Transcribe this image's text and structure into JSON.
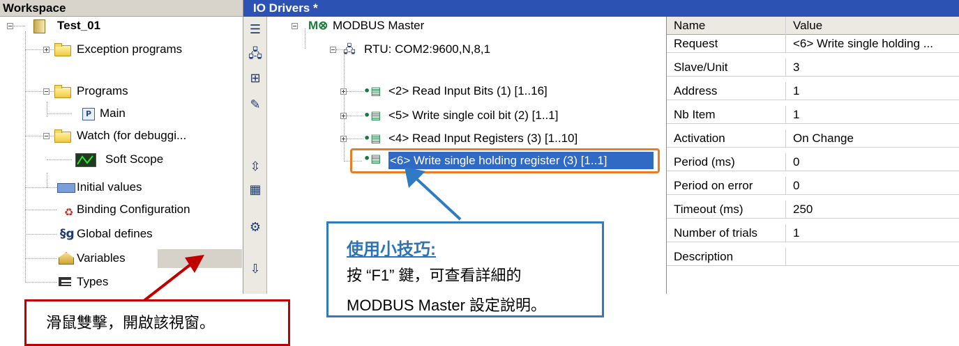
{
  "workspace": {
    "title": "Workspace",
    "project": "Test_01",
    "items": [
      {
        "label": "Exception programs"
      },
      {
        "label": "Programs"
      },
      {
        "label": "Main"
      },
      {
        "label": "Watch (for debuggi..."
      },
      {
        "label": "Soft Scope"
      },
      {
        "label": "Initial values"
      },
      {
        "label": "Binding Configuration"
      },
      {
        "label": "Global defines"
      },
      {
        "label": "Variables"
      },
      {
        "label": "Types"
      }
    ]
  },
  "io": {
    "title": "IO Drivers *",
    "master": "MODBUS Master",
    "rtu": "RTU: COM2:9600,N,8,1",
    "requests": [
      {
        "label": "<2> Read Input Bits (1) [1..16]"
      },
      {
        "label": "<5> Write single coil bit (2) [1..1]"
      },
      {
        "label": "<4> Read Input Registers (3) [1..10]"
      },
      {
        "label": "<6> Write single holding register (3) [1..1]"
      }
    ]
  },
  "properties": {
    "headers": {
      "name": "Name",
      "value": "Value"
    },
    "rows": [
      {
        "name": "Request",
        "value": "<6> Write single holding ..."
      },
      {
        "name": "Slave/Unit",
        "value": "3"
      },
      {
        "name": "Address",
        "value": "1"
      },
      {
        "name": "Nb Item",
        "value": "1"
      },
      {
        "name": "Activation",
        "value": "On Change"
      },
      {
        "name": "Period (ms)",
        "value": "0"
      },
      {
        "name": "Period on error",
        "value": "0"
      },
      {
        "name": "Timeout (ms)",
        "value": "250"
      },
      {
        "name": "Number of trials",
        "value": "1"
      },
      {
        "name": "Description",
        "value": ""
      }
    ]
  },
  "tip": {
    "title": "使用小技巧:",
    "line1": "按 “F1” 鍵，可查看詳細的",
    "line2": "MODBUS Master 設定說明。"
  },
  "hint": {
    "text": "滑鼠雙擊，開啟該視窗。"
  },
  "colors": {
    "io_title_bg": "#2c52b4",
    "selection": "#316ac5",
    "orange": "#ec7c23",
    "tip_border": "#2e7bc2",
    "hint_border": "#c00000"
  }
}
